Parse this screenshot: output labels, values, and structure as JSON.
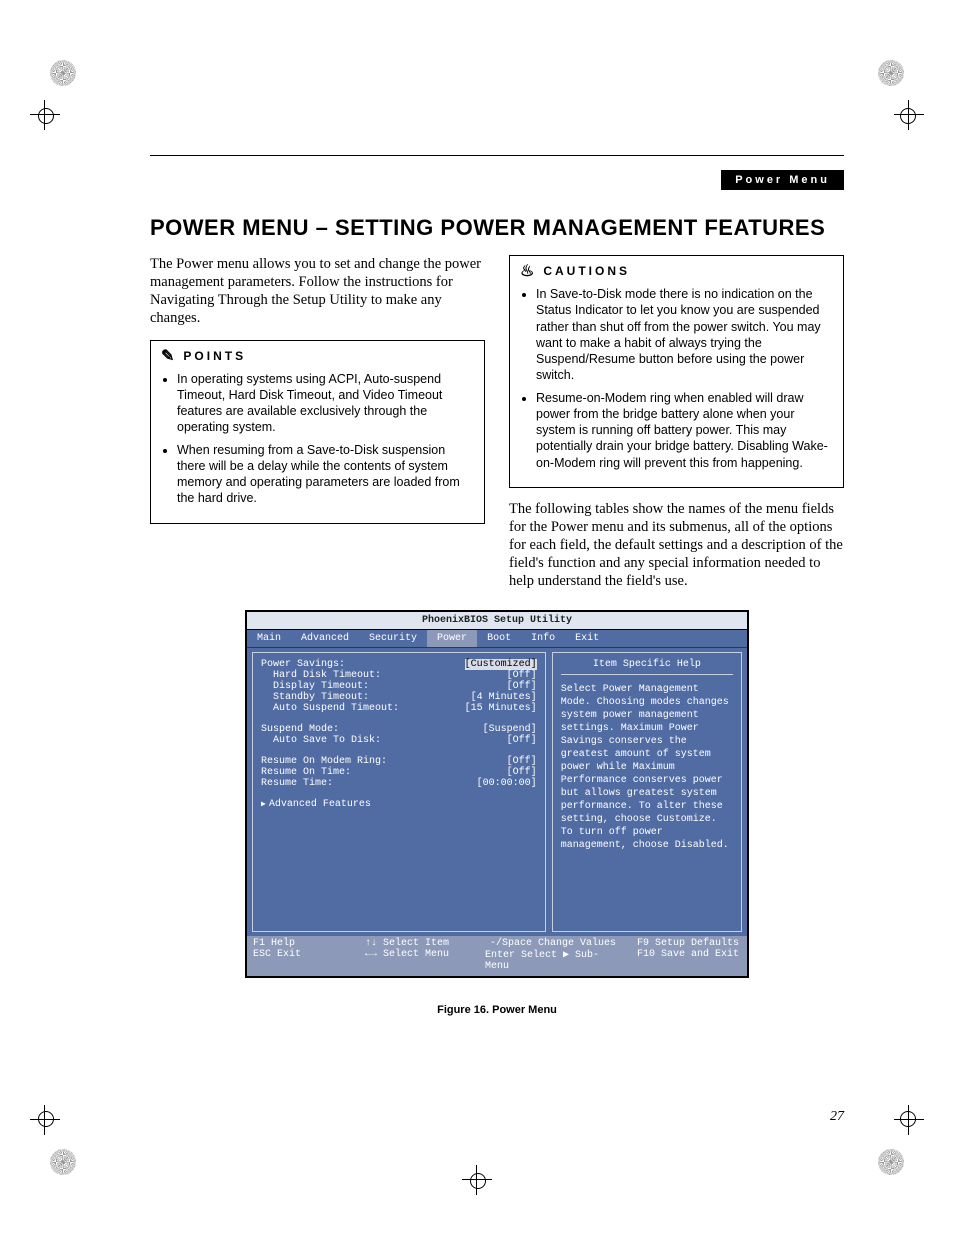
{
  "header_bar": "Power Menu",
  "page_title": "POWER MENU – SETTING POWER MANAGEMENT FEATURES",
  "intro": "The Power menu allows you to set and change the power management parameters. Follow the instructions for Navigating Through the Setup Utility to make any changes.",
  "points_heading": "POINTS",
  "points": [
    "In operating systems using ACPI, Auto-suspend Timeout, Hard Disk Timeout, and Video Timeout features are available exclusively through the operating system.",
    "When resuming from a Save-to-Disk suspension there will be a delay while the contents of system memory and operating parameters are loaded from the hard drive."
  ],
  "cautions_heading": "CAUTIONS",
  "cautions": [
    "In Save-to-Disk mode there is no indication on the Status Indicator to let you know you are suspended rather than shut off from the power switch. You may want to make a habit of always trying the Suspend/Resume button before using the power switch.",
    "Resume-on-Modem ring when enabled will draw power from the bridge battery alone when your system is running off battery power. This may potentially drain your bridge battery. Disabling Wake-on-Modem ring will prevent this from happening."
  ],
  "after_cautions": "The following tables show the names of the menu fields for the Power menu and its submenus, all of the options for each field, the default settings and a description of the field's function and any special information needed to help understand the field's use.",
  "bios": {
    "title": "PhoenixBIOS Setup Utility",
    "tabs": [
      "Main",
      "Advanced",
      "Security",
      "Power",
      "Boot",
      "Info",
      "Exit"
    ],
    "active_tab": "Power",
    "rows": [
      {
        "label": "Power Savings:",
        "value": "[Customized]",
        "selected": true
      },
      {
        "label": "Hard Disk Timeout:",
        "value": "[Off]",
        "indent": true
      },
      {
        "label": "Display Timeout:",
        "value": "[Off]",
        "indent": true
      },
      {
        "label": "Standby Timeout:",
        "value": "[4 Minutes]",
        "indent": true
      },
      {
        "label": "Auto Suspend Timeout:",
        "value": "[15 Minutes]",
        "indent": true
      },
      {
        "spacer": true
      },
      {
        "label": "Suspend Mode:",
        "value": "[Suspend]"
      },
      {
        "label": "Auto Save To Disk:",
        "value": "[Off]",
        "indent": true
      },
      {
        "spacer": true
      },
      {
        "label": "Resume On Modem Ring:",
        "value": "[Off]"
      },
      {
        "label": "Resume On Time:",
        "value": "[Off]"
      },
      {
        "label": "Resume Time:",
        "value": "[00:00:00]"
      },
      {
        "spacer": true
      },
      {
        "label": "Advanced Features",
        "value": "",
        "submenu": true
      }
    ],
    "help_heading": "Item Specific Help",
    "help_text": "Select Power Management Mode. Choosing modes changes system power management settings. Maximum Power Savings conserves the greatest amount of system power while Maximum Performance conserves power but allows greatest system performance. To alter these setting, choose Customize. To turn off power management, choose Disabled.",
    "footer": {
      "row1": [
        {
          "k": "F1",
          "l": "Help"
        },
        {
          "k": "↑↓",
          "l": "Select Item"
        },
        {
          "k": "-/Space",
          "l": "Change Values"
        },
        {
          "k": "F9",
          "l": "Setup Defaults"
        }
      ],
      "row2": [
        {
          "k": "ESC",
          "l": "Exit"
        },
        {
          "k": "←→",
          "l": "Select Menu"
        },
        {
          "k": "Enter",
          "l": "Select ▶ Sub-Menu"
        },
        {
          "k": "F10",
          "l": "Save and Exit"
        }
      ]
    }
  },
  "figure_caption": "Figure 16.  Power Menu",
  "page_number": "27"
}
